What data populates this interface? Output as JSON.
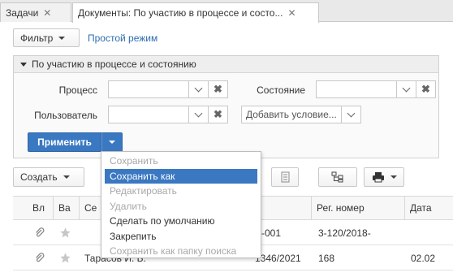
{
  "tabs": [
    {
      "label": "Задачи",
      "close": "✕",
      "active": false
    },
    {
      "label": "Документы: По участию в процессе и состо...",
      "close": "✕",
      "active": true
    }
  ],
  "toolbar": {
    "filter_label": "Фильтр",
    "simple_mode_label": "Простой режим"
  },
  "filter_panel": {
    "title": "По участию в процессе и состоянию",
    "process_label": "Процесс",
    "process_value": "",
    "state_label": "Состояние",
    "state_value": "",
    "user_label": "Пользователь",
    "user_value": "",
    "add_condition_value": "Добавить условие...",
    "apply_label": "Применить"
  },
  "toolbar2": {
    "create_label": "Создать"
  },
  "table": {
    "columns": [
      "Вл",
      "Ва",
      "Се",
      "",
      "Рег. номер",
      "Дата"
    ],
    "rows": [
      {
        "author": "",
        "number_tail": "-001",
        "reg_number": "3-120/2018-",
        "date": ""
      },
      {
        "author": "Тарасов И. Б.",
        "number_tail": "1346/2021",
        "reg_number": "168",
        "date": "02.02"
      }
    ]
  },
  "dropdown_menu": {
    "items": [
      {
        "label": "Сохранить",
        "state": "disabled"
      },
      {
        "label": "Сохранить как",
        "state": "selected"
      },
      {
        "label": "Редактировать",
        "state": "disabled"
      },
      {
        "label": "Удалить",
        "state": "disabled"
      },
      {
        "label": "Сделать по умолчанию",
        "state": "enabled"
      },
      {
        "label": "Закрепить",
        "state": "enabled"
      },
      {
        "label": "Сохранить как папку поиска",
        "state": "disabled"
      }
    ]
  },
  "colors": {
    "accent": "#3a78c2",
    "link": "#2b6cb0",
    "disabled_text": "#a8a8a8"
  }
}
